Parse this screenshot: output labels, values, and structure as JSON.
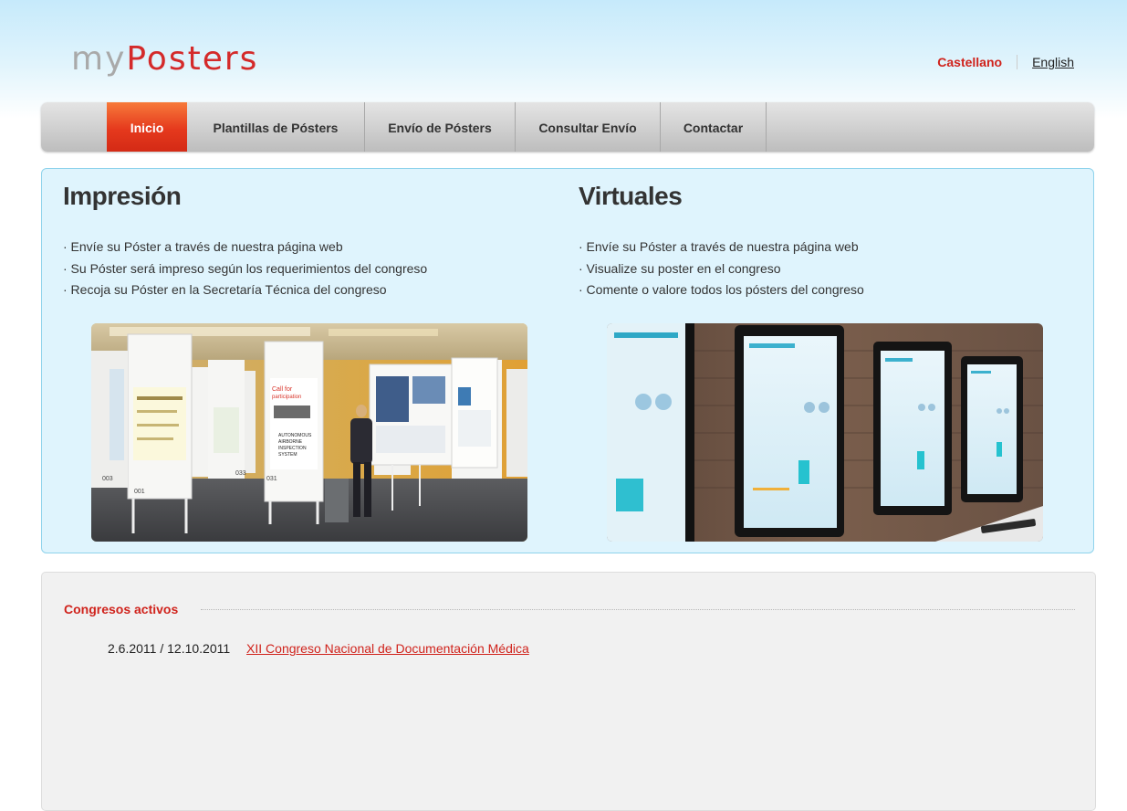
{
  "header": {
    "logo_part1": "my",
    "logo_part2": "Posters",
    "languages": {
      "active": "Castellano",
      "other": "English"
    }
  },
  "nav": {
    "items": [
      {
        "label": "Inicio",
        "active": true
      },
      {
        "label": "Plantillas de Pósters",
        "active": false
      },
      {
        "label": "Envío de Pósters",
        "active": false
      },
      {
        "label": "Consultar Envío",
        "active": false
      },
      {
        "label": "Contactar",
        "active": false
      }
    ]
  },
  "promo": {
    "print": {
      "title": "Impresión",
      "bullets": [
        "· Envíe su Póster a través de nuestra página web",
        "· Su Póster será impreso según los requerimientos del congreso",
        "· Recoja su Póster en la Secretaría Técnica del congreso"
      ]
    },
    "virtual": {
      "title": "Virtuales",
      "bullets": [
        "· Envíe su Póster a través de nuestra página web",
        "· Visualize su poster en el congreso",
        "· Comente o valore todos los pósters del congreso"
      ]
    }
  },
  "congresses": {
    "title": "Congresos activos",
    "items": [
      {
        "dates": "2.6.2011 / 12.10.2011",
        "name": "XII Congreso Nacional de Documentación Médica"
      }
    ]
  },
  "poster_photo": {
    "labels": {
      "call_title": "Call for",
      "call_title2": "participation",
      "poster_line1": "AUTONOMOUS",
      "poster_line2": "AIRBORNE",
      "poster_line3": "INSPECTION",
      "poster_line4": "SYSTEM",
      "num1": "001",
      "num2": "003",
      "num3": "033",
      "num4": "031"
    }
  }
}
